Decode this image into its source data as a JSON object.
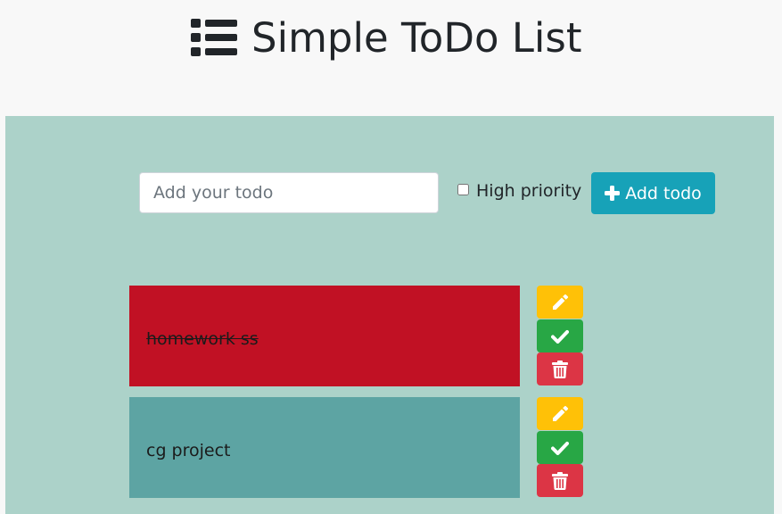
{
  "header": {
    "title": "Simple ToDo List",
    "icon": "list-icon"
  },
  "form": {
    "input_placeholder": "Add your todo",
    "input_value": "",
    "priority_label": "High priority",
    "priority_checked": false,
    "add_button_label": "Add todo",
    "add_button_icon": "plus-icon"
  },
  "todos": [
    {
      "text": "homework ss",
      "high_priority": true,
      "completed": true,
      "color": "#c11124"
    },
    {
      "text": "cg project",
      "high_priority": false,
      "completed": false,
      "color": "#5da4a3"
    }
  ],
  "colors": {
    "panel": "#acd2c9",
    "add_button": "#17a2b8",
    "edit_button": "#ffc107",
    "complete_button": "#28a745",
    "delete_button": "#dc3545"
  }
}
